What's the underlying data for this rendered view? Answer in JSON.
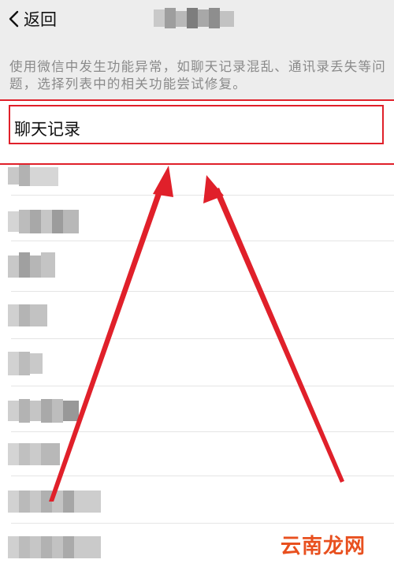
{
  "navbar": {
    "back_label": "返回",
    "back_icon": "chevron-left-icon"
  },
  "description": "使用微信中发生功能异常，如聊天记录混乱、通讯录丢失等问题，选择列表中的相关功能尝试修复。",
  "list": {
    "first_item": "聊天记录"
  },
  "colors": {
    "highlight": "#e0202a",
    "background": "#ededed",
    "watermark": "#e8501f"
  },
  "watermark": "云南龙网"
}
